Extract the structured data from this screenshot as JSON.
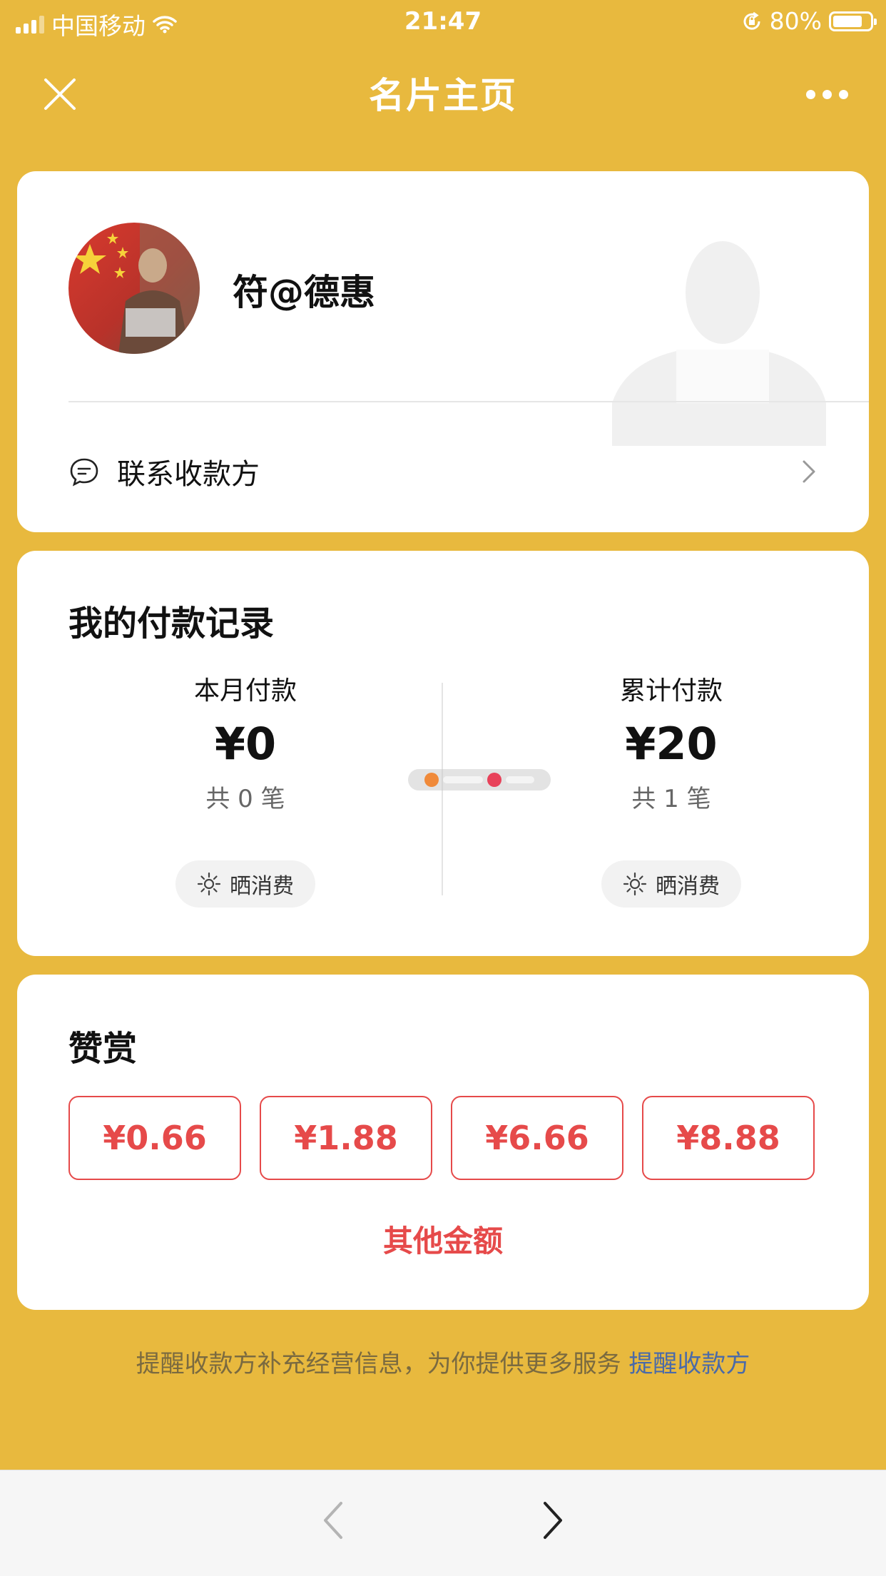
{
  "status_bar": {
    "carrier": "中国移动",
    "time": "21:47",
    "battery": "80%",
    "battery_level": 0.8
  },
  "nav": {
    "title": "名片主页"
  },
  "profile": {
    "name": "符@德惠",
    "contact_label": "联系收款方"
  },
  "payments": {
    "title": "我的付款记录",
    "month": {
      "label": "本月付款",
      "amount": "¥0",
      "count": "共 0 笔",
      "share_label": "晒消费"
    },
    "total": {
      "label": "累计付款",
      "amount": "¥20",
      "count": "共 1 笔",
      "share_label": "晒消费"
    }
  },
  "reward": {
    "title": "赞赏",
    "amounts": [
      "¥0.66",
      "¥1.88",
      "¥6.66",
      "¥8.88"
    ],
    "other_label": "其他金额"
  },
  "footer": {
    "note": "提醒收款方补充经营信息，为你提供更多服务",
    "link": "提醒收款方"
  },
  "colors": {
    "background": "#E8B93E",
    "accent_red": "#E64A4A",
    "link_blue": "#4a6aa8"
  }
}
